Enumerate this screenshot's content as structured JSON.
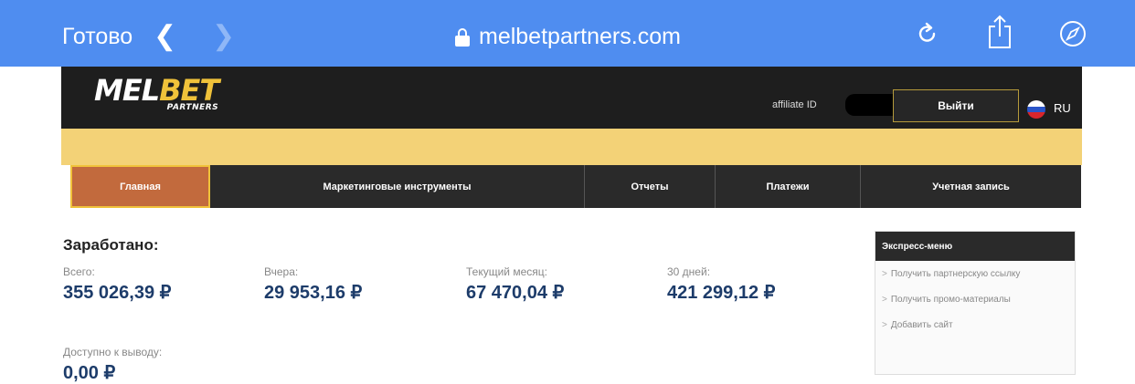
{
  "browser": {
    "done_label": "Готово",
    "back_icon": "chevron-left-icon",
    "forward_icon": "chevron-right-icon",
    "url": "melbetpartners.com",
    "colors": {
      "toolbar": "#4f8df0"
    }
  },
  "header": {
    "logo_main_1": "MEL",
    "logo_main_2": "BET",
    "logo_sub": "PARTNERS",
    "affiliate_label": "affiliate ID",
    "logout_label": "Выйти",
    "language": "RU",
    "colors": {
      "accent": "#f0c23a",
      "background": "#1e1e1e"
    }
  },
  "nav": {
    "items": [
      {
        "label": "Главная",
        "active": true
      },
      {
        "label": "Маркетинговые инструменты",
        "active": false
      },
      {
        "label": "Отчеты",
        "active": false
      },
      {
        "label": "Платежи",
        "active": false
      },
      {
        "label": "Учетная запись",
        "active": false
      }
    ]
  },
  "earnings": {
    "title": "Заработано:",
    "total": {
      "label": "Всего:",
      "value": "355 026,39 ₽"
    },
    "yesterday": {
      "label": "Вчера:",
      "value": "29 953,16 ₽"
    },
    "current_month": {
      "label": "Текущий месяц:",
      "value": "67 470,04 ₽"
    },
    "days30": {
      "label": "30 дней:",
      "value": "421 299,12 ₽"
    },
    "available": {
      "label": "Доступно к выводу:",
      "value": "0,00 ₽"
    }
  },
  "express_menu": {
    "title": "Экспресс-меню",
    "items": [
      "Получить партнерскую ссылку",
      "Получить промо-материалы",
      "Добавить сайт"
    ]
  }
}
